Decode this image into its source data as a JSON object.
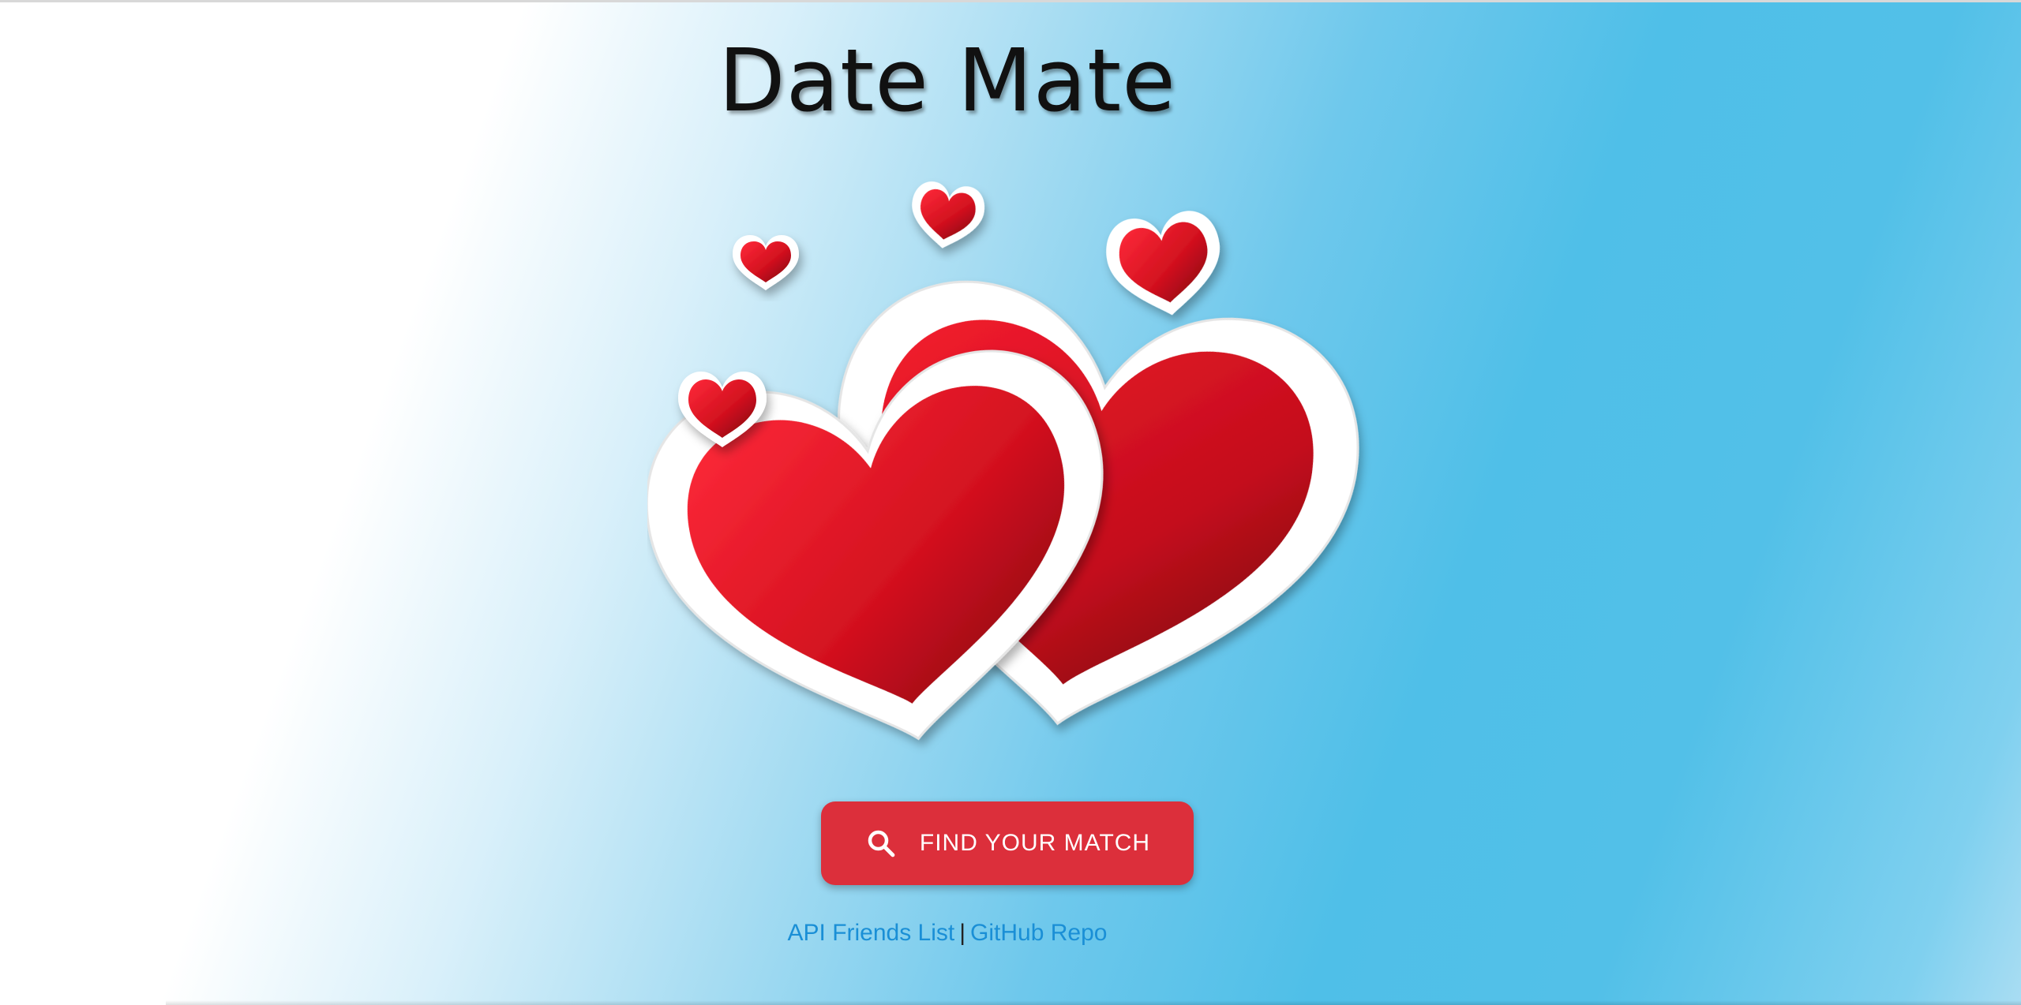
{
  "app": {
    "title": "Date Mate"
  },
  "hero": {
    "image_icon": "hearts-illustration"
  },
  "cta": {
    "label": "FIND YOUR MATCH",
    "icon": "search-icon",
    "color": "#dc2f3b"
  },
  "footer": {
    "api_link": "API Friends List",
    "separator": "|",
    "github_link": "GitHub Repo",
    "link_color": "#1a8fd6"
  }
}
